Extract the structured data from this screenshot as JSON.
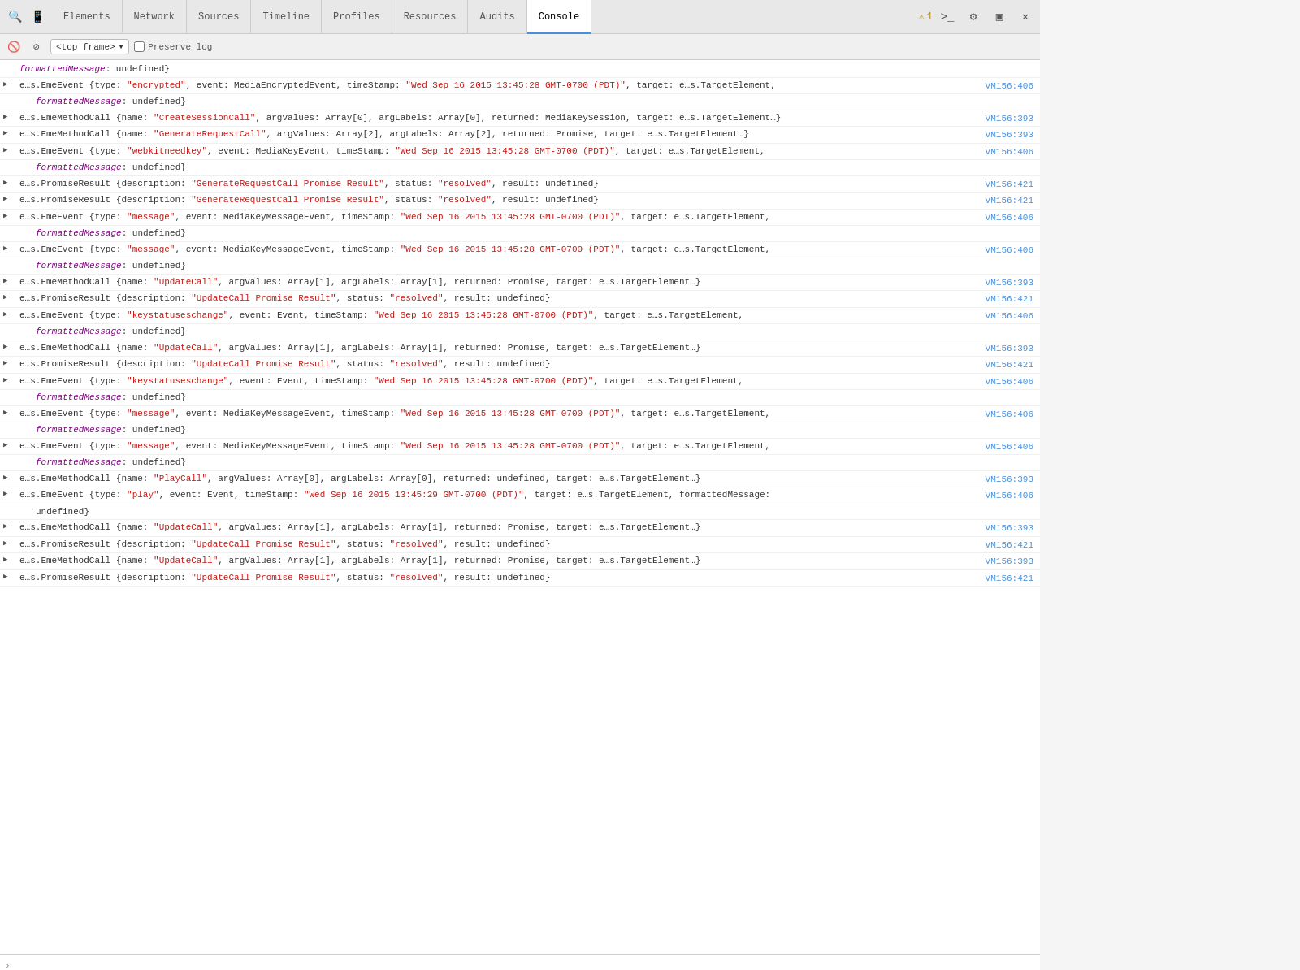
{
  "toolbar": {
    "tabs": [
      {
        "id": "elements",
        "label": "Elements",
        "active": false
      },
      {
        "id": "network",
        "label": "Network",
        "active": false
      },
      {
        "id": "sources",
        "label": "Sources",
        "active": false
      },
      {
        "id": "timeline",
        "label": "Timeline",
        "active": false
      },
      {
        "id": "profiles",
        "label": "Profiles",
        "active": false
      },
      {
        "id": "resources",
        "label": "Resources",
        "active": false
      },
      {
        "id": "audits",
        "label": "Audits",
        "active": false
      },
      {
        "id": "console",
        "label": "Console",
        "active": true
      }
    ],
    "warning_count": "1",
    "frame_selector": "<top frame>",
    "preserve_log": "Preserve log"
  },
  "console_rows": [
    {
      "id": "r1",
      "indent": false,
      "arrow": false,
      "content_parts": [
        {
          "text": "formattedMessage",
          "class": "c-purple italic"
        },
        {
          "text": ": undefined}",
          "class": "c-darkgray"
        }
      ],
      "source": ""
    },
    {
      "id": "r2",
      "arrow": true,
      "content_parts": [
        {
          "text": "e…s.EmeEvent ",
          "class": "c-darkgray"
        },
        {
          "text": "{type: ",
          "class": "c-darkgray"
        },
        {
          "text": "\"encrypted\"",
          "class": "c-red"
        },
        {
          "text": ", event: MediaEncryptedEvent, timeStamp: ",
          "class": "c-darkgray"
        },
        {
          "text": "\"Wed Sep 16 2015 13:45:28 GMT-0700 (PDT)\"",
          "class": "c-red"
        },
        {
          "text": ", target: e…s.TargetElement,",
          "class": "c-darkgray"
        }
      ],
      "source": "VM156:406"
    },
    {
      "id": "r2b",
      "arrow": false,
      "indent": true,
      "content_parts": [
        {
          "text": "formattedMessage",
          "class": "c-purple italic"
        },
        {
          "text": ": undefined}",
          "class": "c-darkgray"
        }
      ],
      "source": ""
    },
    {
      "id": "r3",
      "arrow": true,
      "content_parts": [
        {
          "text": "e…s.EmeMethodCall ",
          "class": "c-darkgray"
        },
        {
          "text": "{name: ",
          "class": "c-darkgray"
        },
        {
          "text": "\"CreateSessionCall\"",
          "class": "c-red"
        },
        {
          "text": ", argValues: Array[0], argLabels: Array[0], returned: MediaKeySession, target: e…s.TargetElement…}",
          "class": "c-darkgray"
        }
      ],
      "source": "VM156:393"
    },
    {
      "id": "r4",
      "arrow": true,
      "content_parts": [
        {
          "text": "e…s.EmeMethodCall ",
          "class": "c-darkgray"
        },
        {
          "text": "{name: ",
          "class": "c-darkgray"
        },
        {
          "text": "\"GenerateRequestCall\"",
          "class": "c-red"
        },
        {
          "text": ", argValues: Array[2], argLabels: Array[2], returned: Promise, target: e…s.TargetElement…}",
          "class": "c-darkgray"
        }
      ],
      "source": "VM156:393"
    },
    {
      "id": "r5",
      "arrow": true,
      "content_parts": [
        {
          "text": "e…s.EmeEvent ",
          "class": "c-darkgray"
        },
        {
          "text": "{type: ",
          "class": "c-darkgray"
        },
        {
          "text": "\"webkitneedkey\"",
          "class": "c-red"
        },
        {
          "text": ", event: MediaKeyEvent, timeStamp: ",
          "class": "c-darkgray"
        },
        {
          "text": "\"Wed Sep 16 2015 13:45:28 GMT-0700 (PDT)\"",
          "class": "c-red"
        },
        {
          "text": ", target: e…s.TargetElement,",
          "class": "c-darkgray"
        }
      ],
      "source": "VM156:406"
    },
    {
      "id": "r5b",
      "arrow": false,
      "indent": true,
      "content_parts": [
        {
          "text": "formattedMessage",
          "class": "c-purple italic"
        },
        {
          "text": ": undefined}",
          "class": "c-darkgray"
        }
      ],
      "source": ""
    },
    {
      "id": "r6",
      "arrow": true,
      "content_parts": [
        {
          "text": "e…s.PromiseResult ",
          "class": "c-darkgray"
        },
        {
          "text": "{description: ",
          "class": "c-darkgray"
        },
        {
          "text": "\"GenerateRequestCall Promise Result\"",
          "class": "c-red"
        },
        {
          "text": ", status: ",
          "class": "c-darkgray"
        },
        {
          "text": "\"resolved\"",
          "class": "c-red"
        },
        {
          "text": ", result: undefined}",
          "class": "c-darkgray"
        }
      ],
      "source": "VM156:421"
    },
    {
      "id": "r7",
      "arrow": true,
      "content_parts": [
        {
          "text": "e…s.PromiseResult ",
          "class": "c-darkgray"
        },
        {
          "text": "{description: ",
          "class": "c-darkgray"
        },
        {
          "text": "\"GenerateRequestCall Promise Result\"",
          "class": "c-red"
        },
        {
          "text": ", status: ",
          "class": "c-darkgray"
        },
        {
          "text": "\"resolved\"",
          "class": "c-red"
        },
        {
          "text": ", result: undefined}",
          "class": "c-darkgray"
        }
      ],
      "source": "VM156:421"
    },
    {
      "id": "r8",
      "arrow": true,
      "content_parts": [
        {
          "text": "e…s.EmeEvent ",
          "class": "c-darkgray"
        },
        {
          "text": "{type: ",
          "class": "c-darkgray"
        },
        {
          "text": "\"message\"",
          "class": "c-red"
        },
        {
          "text": ", event: MediaKeyMessageEvent, timeStamp: ",
          "class": "c-darkgray"
        },
        {
          "text": "\"Wed Sep 16 2015 13:45:28 GMT-0700 (PDT)\"",
          "class": "c-red"
        },
        {
          "text": ", target: e…s.TargetElement,",
          "class": "c-darkgray"
        }
      ],
      "source": "VM156:406"
    },
    {
      "id": "r8b",
      "arrow": false,
      "indent": true,
      "content_parts": [
        {
          "text": "formattedMessage",
          "class": "c-purple italic"
        },
        {
          "text": ": undefined}",
          "class": "c-darkgray"
        }
      ],
      "source": ""
    },
    {
      "id": "r9",
      "arrow": true,
      "content_parts": [
        {
          "text": "e…s.EmeEvent ",
          "class": "c-darkgray"
        },
        {
          "text": "{type: ",
          "class": "c-darkgray"
        },
        {
          "text": "\"message\"",
          "class": "c-red"
        },
        {
          "text": ", event: MediaKeyMessageEvent, timeStamp: ",
          "class": "c-darkgray"
        },
        {
          "text": "\"Wed Sep 16 2015 13:45:28 GMT-0700 (PDT)\"",
          "class": "c-red"
        },
        {
          "text": ", target: e…s.TargetElement,",
          "class": "c-darkgray"
        }
      ],
      "source": "VM156:406"
    },
    {
      "id": "r9b",
      "arrow": false,
      "indent": true,
      "content_parts": [
        {
          "text": "formattedMessage",
          "class": "c-purple italic"
        },
        {
          "text": ": undefined}",
          "class": "c-darkgray"
        }
      ],
      "source": ""
    },
    {
      "id": "r10",
      "arrow": true,
      "content_parts": [
        {
          "text": "e…s.EmeMethodCall ",
          "class": "c-darkgray"
        },
        {
          "text": "{name: ",
          "class": "c-darkgray"
        },
        {
          "text": "\"UpdateCall\"",
          "class": "c-red"
        },
        {
          "text": ", argValues: Array[1], argLabels: Array[1], returned: Promise, target: e…s.TargetElement…}",
          "class": "c-darkgray"
        }
      ],
      "source": "VM156:393"
    },
    {
      "id": "r11",
      "arrow": true,
      "content_parts": [
        {
          "text": "e…s.PromiseResult ",
          "class": "c-darkgray"
        },
        {
          "text": "{description: ",
          "class": "c-darkgray"
        },
        {
          "text": "\"UpdateCall Promise Result\"",
          "class": "c-red"
        },
        {
          "text": ", status: ",
          "class": "c-darkgray"
        },
        {
          "text": "\"resolved\"",
          "class": "c-red"
        },
        {
          "text": ", result: undefined}",
          "class": "c-darkgray"
        }
      ],
      "source": "VM156:421"
    },
    {
      "id": "r12",
      "arrow": true,
      "content_parts": [
        {
          "text": "e…s.EmeEvent ",
          "class": "c-darkgray"
        },
        {
          "text": "{type: ",
          "class": "c-darkgray"
        },
        {
          "text": "\"keystatuseschange\"",
          "class": "c-red"
        },
        {
          "text": ", event: Event, timeStamp: ",
          "class": "c-darkgray"
        },
        {
          "text": "\"Wed Sep 16 2015 13:45:28 GMT-0700 (PDT)\"",
          "class": "c-red"
        },
        {
          "text": ", target: e…s.TargetElement,",
          "class": "c-darkgray"
        }
      ],
      "source": "VM156:406"
    },
    {
      "id": "r12b",
      "arrow": false,
      "indent": true,
      "content_parts": [
        {
          "text": "formattedMessage",
          "class": "c-purple italic"
        },
        {
          "text": ": undefined}",
          "class": "c-darkgray"
        }
      ],
      "source": ""
    },
    {
      "id": "r13",
      "arrow": true,
      "content_parts": [
        {
          "text": "e…s.EmeMethodCall ",
          "class": "c-darkgray"
        },
        {
          "text": "{name: ",
          "class": "c-darkgray"
        },
        {
          "text": "\"UpdateCall\"",
          "class": "c-red"
        },
        {
          "text": ", argValues: Array[1], argLabels: Array[1], returned: Promise, target: e…s.TargetElement…}",
          "class": "c-darkgray"
        }
      ],
      "source": "VM156:393"
    },
    {
      "id": "r14",
      "arrow": true,
      "content_parts": [
        {
          "text": "e…s.PromiseResult ",
          "class": "c-darkgray"
        },
        {
          "text": "{description: ",
          "class": "c-darkgray"
        },
        {
          "text": "\"UpdateCall Promise Result\"",
          "class": "c-red"
        },
        {
          "text": ", status: ",
          "class": "c-darkgray"
        },
        {
          "text": "\"resolved\"",
          "class": "c-red"
        },
        {
          "text": ", result: undefined}",
          "class": "c-darkgray"
        }
      ],
      "source": "VM156:421"
    },
    {
      "id": "r15",
      "arrow": true,
      "content_parts": [
        {
          "text": "e…s.EmeEvent ",
          "class": "c-darkgray"
        },
        {
          "text": "{type: ",
          "class": "c-darkgray"
        },
        {
          "text": "\"keystatuseschange\"",
          "class": "c-red"
        },
        {
          "text": ", event: Event, timeStamp: ",
          "class": "c-darkgray"
        },
        {
          "text": "\"Wed Sep 16 2015 13:45:28 GMT-0700 (PDT)\"",
          "class": "c-red"
        },
        {
          "text": ", target: e…s.TargetElement,",
          "class": "c-darkgray"
        }
      ],
      "source": "VM156:406"
    },
    {
      "id": "r15b",
      "arrow": false,
      "indent": true,
      "content_parts": [
        {
          "text": "formattedMessage",
          "class": "c-purple italic"
        },
        {
          "text": ": undefined}",
          "class": "c-darkgray"
        }
      ],
      "source": ""
    },
    {
      "id": "r16",
      "arrow": true,
      "content_parts": [
        {
          "text": "e…s.EmeEvent ",
          "class": "c-darkgray"
        },
        {
          "text": "{type: ",
          "class": "c-darkgray"
        },
        {
          "text": "\"message\"",
          "class": "c-red"
        },
        {
          "text": ", event: MediaKeyMessageEvent, timeStamp: ",
          "class": "c-darkgray"
        },
        {
          "text": "\"Wed Sep 16 2015 13:45:28 GMT-0700 (PDT)\"",
          "class": "c-red"
        },
        {
          "text": ", target: e…s.TargetElement,",
          "class": "c-darkgray"
        }
      ],
      "source": "VM156:406"
    },
    {
      "id": "r16b",
      "arrow": false,
      "indent": true,
      "content_parts": [
        {
          "text": "formattedMessage",
          "class": "c-purple italic"
        },
        {
          "text": ": undefined}",
          "class": "c-darkgray"
        }
      ],
      "source": ""
    },
    {
      "id": "r17",
      "arrow": true,
      "content_parts": [
        {
          "text": "e…s.EmeEvent ",
          "class": "c-darkgray"
        },
        {
          "text": "{type: ",
          "class": "c-darkgray"
        },
        {
          "text": "\"message\"",
          "class": "c-red"
        },
        {
          "text": ", event: MediaKeyMessageEvent, timeStamp: ",
          "class": "c-darkgray"
        },
        {
          "text": "\"Wed Sep 16 2015 13:45:28 GMT-0700 (PDT)\"",
          "class": "c-red"
        },
        {
          "text": ", target: e…s.TargetElement,",
          "class": "c-darkgray"
        }
      ],
      "source": "VM156:406"
    },
    {
      "id": "r17b",
      "arrow": false,
      "indent": true,
      "content_parts": [
        {
          "text": "formattedMessage",
          "class": "c-purple italic"
        },
        {
          "text": ": undefined}",
          "class": "c-darkgray"
        }
      ],
      "source": ""
    },
    {
      "id": "r18",
      "arrow": true,
      "content_parts": [
        {
          "text": "e…s.EmeMethodCall ",
          "class": "c-darkgray"
        },
        {
          "text": "{name: ",
          "class": "c-darkgray"
        },
        {
          "text": "\"PlayCall\"",
          "class": "c-red"
        },
        {
          "text": ", argValues: Array[0], argLabels: Array[0], returned: undefined, target: e…s.TargetElement…}",
          "class": "c-darkgray"
        }
      ],
      "source": "VM156:393"
    },
    {
      "id": "r19",
      "arrow": true,
      "content_parts": [
        {
          "text": "e…s.EmeEvent ",
          "class": "c-darkgray"
        },
        {
          "text": "{type: ",
          "class": "c-darkgray"
        },
        {
          "text": "\"play\"",
          "class": "c-red"
        },
        {
          "text": ", event: Event, timeStamp: ",
          "class": "c-darkgray"
        },
        {
          "text": "\"Wed Sep 16 2015 13:45:29 GMT-0700 (PDT)\"",
          "class": "c-red"
        },
        {
          "text": ", target: e…s.TargetElement, formattedMessage:",
          "class": "c-darkgray"
        }
      ],
      "source": "VM156:406"
    },
    {
      "id": "r19b",
      "arrow": false,
      "indent": true,
      "content_parts": [
        {
          "text": "undefined}",
          "class": "c-darkgray"
        }
      ],
      "source": ""
    },
    {
      "id": "r20",
      "arrow": true,
      "content_parts": [
        {
          "text": "e…s.EmeMethodCall ",
          "class": "c-darkgray"
        },
        {
          "text": "{name: ",
          "class": "c-darkgray"
        },
        {
          "text": "\"UpdateCall\"",
          "class": "c-red"
        },
        {
          "text": ", argValues: Array[1], argLabels: Array[1], returned: Promise, target: e…s.TargetElement…}",
          "class": "c-darkgray"
        }
      ],
      "source": "VM156:393"
    },
    {
      "id": "r21",
      "arrow": true,
      "content_parts": [
        {
          "text": "e…s.PromiseResult ",
          "class": "c-darkgray"
        },
        {
          "text": "{description: ",
          "class": "c-darkgray"
        },
        {
          "text": "\"UpdateCall Promise Result\"",
          "class": "c-red"
        },
        {
          "text": ", status: ",
          "class": "c-darkgray"
        },
        {
          "text": "\"resolved\"",
          "class": "c-red"
        },
        {
          "text": ", result: undefined}",
          "class": "c-darkgray"
        }
      ],
      "source": "VM156:421"
    },
    {
      "id": "r22",
      "arrow": true,
      "content_parts": [
        {
          "text": "e…s.EmeMethodCall ",
          "class": "c-darkgray"
        },
        {
          "text": "{name: ",
          "class": "c-darkgray"
        },
        {
          "text": "\"UpdateCall\"",
          "class": "c-red"
        },
        {
          "text": ", argValues: Array[1], argLabels: Array[1], returned: Promise, target: e…s.TargetElement…}",
          "class": "c-darkgray"
        }
      ],
      "source": "VM156:393"
    },
    {
      "id": "r23",
      "arrow": true,
      "content_parts": [
        {
          "text": "e…s.PromiseResult ",
          "class": "c-darkgray"
        },
        {
          "text": "{description: ",
          "class": "c-darkgray"
        },
        {
          "text": "\"UpdateCall Promise Result\"",
          "class": "c-red"
        },
        {
          "text": ", status: ",
          "class": "c-darkgray"
        },
        {
          "text": "\"resolved\"",
          "class": "c-red"
        },
        {
          "text": ", result: undefined}",
          "class": "c-darkgray"
        }
      ],
      "source": "VM156:421"
    }
  ],
  "console_input": {
    "prompt": ">",
    "placeholder": ""
  }
}
